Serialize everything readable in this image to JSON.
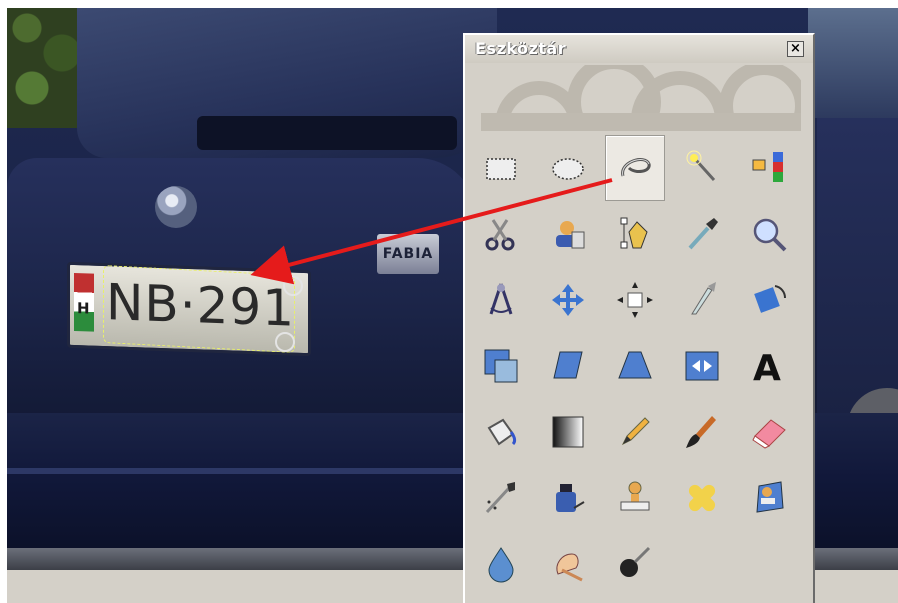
{
  "window": {
    "title": "Eszköztár",
    "close_label": "×"
  },
  "photo": {
    "plate_country": "H",
    "plate_text": "NB·291",
    "badge_text": "FABIA"
  },
  "tools": [
    {
      "id": "rect-select",
      "icon": "rectangle-select-icon",
      "row": 0,
      "col": 0
    },
    {
      "id": "ellipse-select",
      "icon": "ellipse-select-icon",
      "row": 0,
      "col": 1
    },
    {
      "id": "free-select",
      "icon": "lasso-select-icon",
      "row": 0,
      "col": 2,
      "active": true
    },
    {
      "id": "fuzzy-select",
      "icon": "magic-wand-icon",
      "row": 0,
      "col": 3
    },
    {
      "id": "color-select",
      "icon": "select-by-color-icon",
      "row": 0,
      "col": 4
    },
    {
      "id": "scissors",
      "icon": "scissors-icon",
      "row": 1,
      "col": 0
    },
    {
      "id": "foreground-select",
      "icon": "foreground-select-icon",
      "row": 1,
      "col": 1
    },
    {
      "id": "paths",
      "icon": "paths-pen-icon",
      "row": 1,
      "col": 2
    },
    {
      "id": "color-picker",
      "icon": "eyedropper-icon",
      "row": 1,
      "col": 3
    },
    {
      "id": "zoom",
      "icon": "magnifier-icon",
      "row": 1,
      "col": 4
    },
    {
      "id": "measure",
      "icon": "compass-measure-icon",
      "row": 2,
      "col": 0
    },
    {
      "id": "move",
      "icon": "move-arrows-icon",
      "row": 2,
      "col": 1
    },
    {
      "id": "align",
      "icon": "align-icon",
      "row": 2,
      "col": 2
    },
    {
      "id": "crop",
      "icon": "crop-knife-icon",
      "row": 2,
      "col": 3
    },
    {
      "id": "rotate",
      "icon": "rotate-icon",
      "row": 2,
      "col": 4
    },
    {
      "id": "scale",
      "icon": "scale-icon",
      "row": 3,
      "col": 0
    },
    {
      "id": "shear",
      "icon": "shear-icon",
      "row": 3,
      "col": 1
    },
    {
      "id": "perspective",
      "icon": "perspective-icon",
      "row": 3,
      "col": 2
    },
    {
      "id": "flip",
      "icon": "flip-icon",
      "row": 3,
      "col": 3
    },
    {
      "id": "text",
      "icon": "text-a-icon",
      "row": 3,
      "col": 4
    },
    {
      "id": "bucket-fill",
      "icon": "paint-bucket-icon",
      "row": 4,
      "col": 0
    },
    {
      "id": "blend",
      "icon": "gradient-icon",
      "row": 4,
      "col": 1
    },
    {
      "id": "pencil",
      "icon": "pencil-icon",
      "row": 4,
      "col": 2
    },
    {
      "id": "paintbrush",
      "icon": "paintbrush-icon",
      "row": 4,
      "col": 3
    },
    {
      "id": "eraser",
      "icon": "eraser-icon",
      "row": 4,
      "col": 4
    },
    {
      "id": "airbrush",
      "icon": "airbrush-icon",
      "row": 5,
      "col": 0
    },
    {
      "id": "ink",
      "icon": "ink-bottle-icon",
      "row": 5,
      "col": 1
    },
    {
      "id": "clone",
      "icon": "clone-stamp-icon",
      "row": 5,
      "col": 2
    },
    {
      "id": "heal",
      "icon": "bandage-heal-icon",
      "row": 5,
      "col": 3
    },
    {
      "id": "perspective-clone",
      "icon": "perspective-clone-icon",
      "row": 5,
      "col": 4
    },
    {
      "id": "blur-sharpen",
      "icon": "water-drop-icon",
      "row": 6,
      "col": 0
    },
    {
      "id": "smudge",
      "icon": "smudge-finger-icon",
      "row": 6,
      "col": 1
    },
    {
      "id": "dodge-burn",
      "icon": "dodge-burn-icon",
      "row": 6,
      "col": 2
    }
  ],
  "colors": {
    "arrow": "#e51b1b",
    "selection": "#e8f06a",
    "toolbox_bg": "#d4d0c8"
  }
}
